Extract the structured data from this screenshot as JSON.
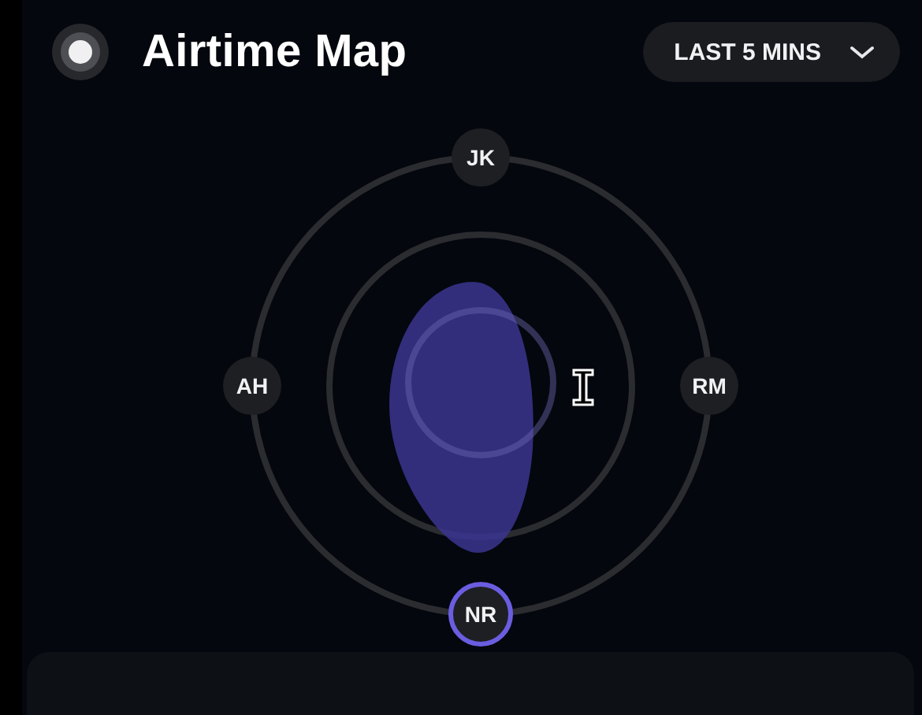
{
  "header": {
    "title": "Airtime Map",
    "range": {
      "label": "LAST 5 MINS"
    }
  },
  "participants": [
    {
      "label": "JK",
      "selected": false
    },
    {
      "label": "RM",
      "selected": false
    },
    {
      "label": "NR",
      "selected": true
    },
    {
      "label": "AH",
      "selected": false
    }
  ]
}
